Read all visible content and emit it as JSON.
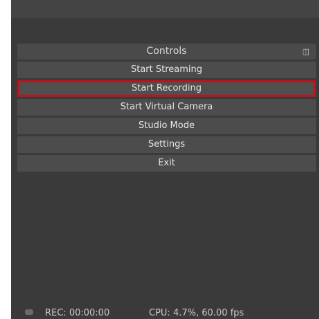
{
  "dock": {
    "title": "Controls",
    "float_icon": "undock-icon"
  },
  "controls": [
    {
      "label": "Start Streaming",
      "highlighted": false
    },
    {
      "label": "Start Recording",
      "highlighted": true
    },
    {
      "label": "Start Virtual Camera",
      "highlighted": false
    },
    {
      "label": "Studio Mode",
      "highlighted": false
    },
    {
      "label": "Settings",
      "highlighted": false
    },
    {
      "label": "Exit",
      "highlighted": false
    }
  ],
  "status": {
    "rec": "REC: 00:00:00",
    "cpu": "CPU: 4.7%, 60.00 fps"
  },
  "colors": {
    "background": "#3a3a3a",
    "button": "#4c4c4c",
    "highlight": "#c0121a"
  }
}
